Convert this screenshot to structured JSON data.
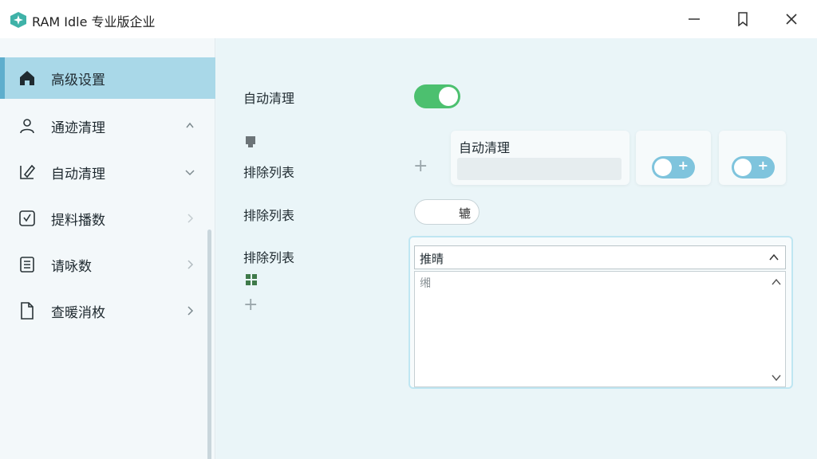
{
  "app": {
    "title": "RAM Idle 专业版企业"
  },
  "window": {
    "minimize_icon": "minimize-icon",
    "maximize_icon": "maximize-icon",
    "close_icon": "close-icon"
  },
  "sidebar": {
    "items": [
      {
        "label": "高级设置",
        "icon": "home-icon",
        "active": true
      },
      {
        "label": "通迹清理",
        "icon": "user-icon"
      },
      {
        "label": "自动清理",
        "icon": "edit-icon"
      },
      {
        "label": "提料播数",
        "icon": "checkbox-icon"
      },
      {
        "label": "请咏数",
        "icon": "list-icon"
      },
      {
        "label": "查暖消枚",
        "icon": "document-icon"
      }
    ]
  },
  "main": {
    "auto_clean_label": "自动清理",
    "auto_clean_on": true,
    "exclude_list_label_1": "排除列表",
    "exclude_list_label_2": "排除列表",
    "exclude_list_label_3": "排除列表",
    "card_title": "自动清理",
    "pill_value": "辘",
    "combo_value": "推晴",
    "list_item": "缃"
  },
  "colors": {
    "accent": "#a9d8e8",
    "toggle_on": "#4cc06f",
    "toggle_blue": "#7fc4dd"
  }
}
